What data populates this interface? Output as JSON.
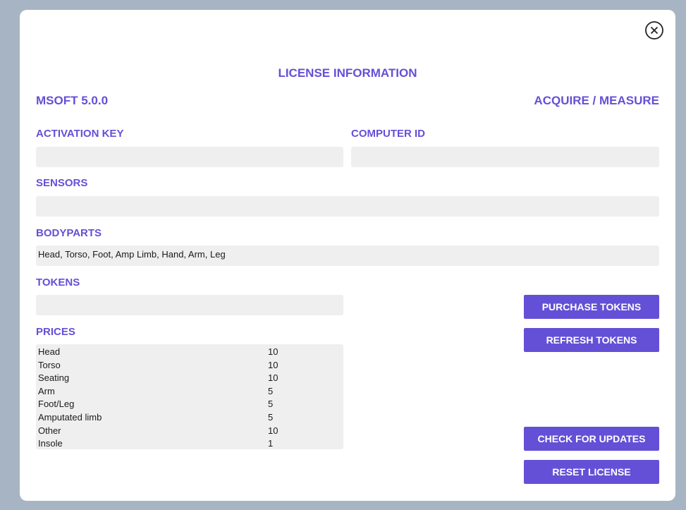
{
  "dialog": {
    "title": "LICENSE INFORMATION",
    "product_name": "MSOFT 5.0.0",
    "product_mode": "ACQUIRE / MEASURE"
  },
  "fields": {
    "activation_key": {
      "label": "ACTIVATION KEY",
      "value": ""
    },
    "computer_id": {
      "label": "COMPUTER ID",
      "value": ""
    },
    "sensors": {
      "label": "SENSORS",
      "value": ""
    },
    "bodyparts": {
      "label": "BODYPARTS",
      "value": "Head, Torso, Foot, Amp Limb, Hand, Arm, Leg"
    },
    "tokens": {
      "label": "TOKENS",
      "value": ""
    }
  },
  "prices": {
    "label": "PRICES",
    "items": [
      {
        "name": "Head",
        "value": "10"
      },
      {
        "name": "Torso",
        "value": "10"
      },
      {
        "name": "Seating",
        "value": "10"
      },
      {
        "name": "Arm",
        "value": "5"
      },
      {
        "name": "Foot/Leg",
        "value": "5"
      },
      {
        "name": "Amputated limb",
        "value": "5"
      },
      {
        "name": "Other",
        "value": "10"
      },
      {
        "name": "Insole",
        "value": "1"
      }
    ]
  },
  "buttons": {
    "purchase_tokens": "PURCHASE TOKENS",
    "refresh_tokens": "REFRESH TOKENS",
    "check_updates": "CHECK FOR UPDATES",
    "reset_license": "RESET LICENSE"
  },
  "icons": {
    "close": "close-icon"
  },
  "colors": {
    "accent": "#6450d6",
    "field_background": "#efefef",
    "backdrop": "#a7b4c3"
  }
}
